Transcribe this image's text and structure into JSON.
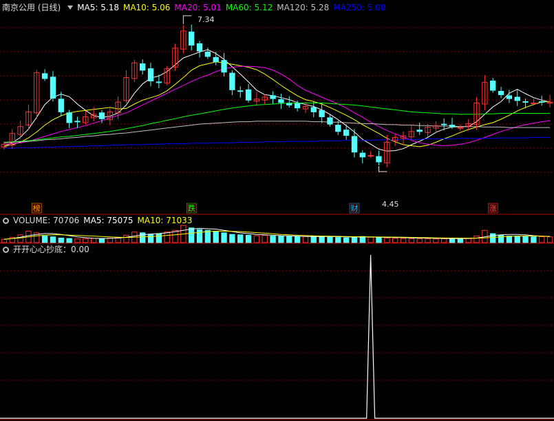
{
  "main_panel": {
    "stock_title": "南京公用 (日线)",
    "indicators": [
      {
        "label": "MA5: 5.18",
        "color": "#ffffff"
      },
      {
        "label": "MA10: 5.06",
        "color": "#ffff00"
      },
      {
        "label": "MA20: 5.01",
        "color": "#ff00ff"
      },
      {
        "label": "MA60: 5.12",
        "color": "#00ff00"
      },
      {
        "label": "MA120: 5.28",
        "color": "#c0c0c0"
      },
      {
        "label": "MA250: 5.08",
        "color": "#0000ff"
      }
    ],
    "high_label": "7.34",
    "low_label": "4.45",
    "event_tags": [
      {
        "text": "榜",
        "color": "#ffa500"
      },
      {
        "text": "跌",
        "color": "#00ff00"
      },
      {
        "text": "财",
        "color": "#00bfff"
      },
      {
        "text": "涨",
        "color": "#ff4040"
      }
    ]
  },
  "volume_panel": {
    "label_volume": "VOLUME: 70706",
    "label_ma5": "MA5: 75075",
    "label_ma10": "MA10: 71033"
  },
  "indicator_panel": {
    "label": "开开心心抄底：0.00"
  },
  "colors": {
    "up": "#ff3232",
    "down": "#54ffff",
    "grid": "#8b0000",
    "border": "#b00000",
    "ma5": "#ffffff",
    "ma10": "#ffff00",
    "ma20": "#ff00ff",
    "ma60": "#00ff00",
    "ma120": "#c0c0c0",
    "ma250": "#0000ff"
  },
  "chart_data": [
    {
      "type": "candlestick",
      "title": "南京公用 (日线)",
      "ylim": [
        4.2,
        7.6
      ],
      "close": [
        4.94,
        5.16,
        5.3,
        5.6,
        6.4,
        6.28,
        5.88,
        5.6,
        5.38,
        5.4,
        5.5,
        5.55,
        5.46,
        5.6,
        5.8,
        6.3,
        6.6,
        6.45,
        6.23,
        6.21,
        6.48,
        6.9,
        7.25,
        6.96,
        6.84,
        6.73,
        6.62,
        6.41,
        6.05,
        6.02,
        5.84,
        5.86,
        5.9,
        5.87,
        5.79,
        5.74,
        5.68,
        5.71,
        5.6,
        5.5,
        5.35,
        5.2,
        5.12,
        4.78,
        4.68,
        4.71,
        4.58,
        4.98,
        5.08,
        5.11,
        5.2,
        5.2,
        5.29,
        5.32,
        5.35,
        5.3,
        5.28,
        5.36,
        5.78,
        6.2,
        6.04,
        5.95,
        5.87,
        5.83,
        5.8,
        5.78,
        5.8,
        5.8
      ],
      "series": [
        {
          "name": "MA5",
          "values": [
            4.9,
            4.97,
            5.08,
            5.25,
            5.49,
            5.75,
            5.9,
            5.96,
            5.91,
            5.76,
            5.63,
            5.52,
            5.49,
            5.51,
            5.58,
            5.74,
            5.98,
            6.17,
            6.29,
            6.33,
            6.42,
            6.56,
            6.7,
            6.76,
            6.82,
            6.87,
            6.79,
            6.67,
            6.52,
            6.37,
            6.21,
            6.04,
            5.95,
            5.93,
            5.89,
            5.85,
            5.79,
            5.75,
            5.71,
            5.64,
            5.55,
            5.44,
            5.32,
            5.19,
            5.04,
            4.94,
            4.84,
            4.8,
            4.81,
            4.85,
            4.93,
            5.0,
            5.08,
            5.18,
            5.25,
            5.29,
            5.3,
            5.3,
            5.4,
            5.55,
            5.7,
            5.81,
            5.98,
            6.06,
            5.97,
            5.89,
            5.84,
            5.8
          ]
        },
        {
          "name": "MA10",
          "values": [
            4.9,
            4.93,
            4.98,
            5.07,
            5.19,
            5.33,
            5.44,
            5.52,
            5.58,
            5.61,
            5.63,
            5.65,
            5.67,
            5.69,
            5.66,
            5.67,
            5.76,
            5.84,
            5.89,
            5.94,
            6.03,
            6.16,
            6.3,
            6.45,
            6.54,
            6.58,
            6.62,
            6.6,
            6.57,
            6.54,
            6.51,
            6.46,
            6.37,
            6.26,
            6.14,
            6.03,
            5.93,
            5.85,
            5.81,
            5.76,
            5.69,
            5.61,
            5.53,
            5.44,
            5.34,
            5.25,
            5.16,
            5.06,
            4.99,
            4.93,
            4.91,
            4.89,
            4.92,
            4.98,
            5.05,
            5.11,
            5.18,
            5.24,
            5.29,
            5.34,
            5.38,
            5.45,
            5.53,
            5.62,
            5.69,
            5.75,
            5.8,
            5.81
          ]
        },
        {
          "name": "MA20",
          "values": [
            4.94,
            4.95,
            4.97,
            5.0,
            5.05,
            5.1,
            5.15,
            5.2,
            5.24,
            5.28,
            5.32,
            5.37,
            5.42,
            5.48,
            5.53,
            5.58,
            5.66,
            5.74,
            5.82,
            5.9,
            5.98,
            6.06,
            6.14,
            6.22,
            6.29,
            6.35,
            6.42,
            6.48,
            6.51,
            6.53,
            6.53,
            6.52,
            6.5,
            6.45,
            6.37,
            6.27,
            6.14,
            6.04,
            5.97,
            5.9,
            5.83,
            5.76,
            5.68,
            5.58,
            5.49,
            5.39,
            5.3,
            5.22,
            5.15,
            5.09,
            5.02,
            4.97,
            4.94,
            4.92,
            4.91,
            4.92,
            4.94,
            4.97,
            5.02,
            5.08,
            5.14,
            5.2,
            5.25,
            5.3,
            5.34,
            5.37,
            5.4,
            5.42
          ]
        },
        {
          "name": "MA60",
          "values": [
            4.98,
            4.99,
            5.0,
            5.01,
            5.03,
            5.05,
            5.07,
            5.09,
            5.1,
            5.12,
            5.14,
            5.16,
            5.18,
            5.2,
            5.23,
            5.26,
            5.29,
            5.32,
            5.36,
            5.39,
            5.43,
            5.46,
            5.5,
            5.53,
            5.56,
            5.59,
            5.62,
            5.65,
            5.68,
            5.7,
            5.72,
            5.74,
            5.75,
            5.76,
            5.77,
            5.78,
            5.78,
            5.78,
            5.78,
            5.78,
            5.77,
            5.76,
            5.75,
            5.74,
            5.72,
            5.7,
            5.68,
            5.66,
            5.64,
            5.62,
            5.6,
            5.59,
            5.58,
            5.57,
            5.56,
            5.56,
            5.55,
            5.55,
            5.55,
            5.56,
            5.56,
            5.57,
            5.57,
            5.57,
            5.57,
            5.57,
            5.57,
            5.57
          ]
        },
        {
          "name": "MA120",
          "values": [
            4.97,
            4.98,
            4.99,
            5.0,
            5.01,
            5.03,
            5.04,
            5.05,
            5.07,
            5.08,
            5.1,
            5.11,
            5.13,
            5.14,
            5.16,
            5.17,
            5.19,
            5.21,
            5.23,
            5.25,
            5.27,
            5.29,
            5.31,
            5.33,
            5.35,
            5.36,
            5.37,
            5.38,
            5.39,
            5.4,
            5.4,
            5.41,
            5.41,
            5.41,
            5.41,
            5.41,
            5.41,
            5.41,
            5.4,
            5.4,
            5.39,
            5.39,
            5.38,
            5.37,
            5.36,
            5.36,
            5.35,
            5.34,
            5.34,
            5.33,
            5.33,
            5.32,
            5.32,
            5.31,
            5.31,
            5.31,
            5.3,
            5.3,
            5.3,
            5.29,
            5.29,
            5.29,
            5.28,
            5.28,
            5.28,
            5.28,
            5.28,
            5.28
          ]
        },
        {
          "name": "MA250",
          "values": [
            4.86,
            4.86,
            4.87,
            4.87,
            4.87,
            4.88,
            4.88,
            4.89,
            4.89,
            4.9,
            4.9,
            4.91,
            4.91,
            4.92,
            4.92,
            4.93,
            4.93,
            4.93,
            4.94,
            4.94,
            4.95,
            4.95,
            4.95,
            4.96,
            4.96,
            4.96,
            4.97,
            4.97,
            4.97,
            4.98,
            4.98,
            4.98,
            4.99,
            4.99,
            4.99,
            5.0,
            5.0,
            5.0,
            5.0,
            5.01,
            5.01,
            5.01,
            5.02,
            5.02,
            5.02,
            5.02,
            5.03,
            5.03,
            5.03,
            5.04,
            5.04,
            5.04,
            5.05,
            5.05,
            5.05,
            5.05,
            5.06,
            5.06,
            5.06,
            5.06,
            5.06,
            5.07,
            5.07,
            5.07,
            5.07,
            5.08,
            5.08,
            5.08
          ]
        }
      ]
    },
    {
      "type": "bar",
      "title": "VOLUME",
      "values": [
        40,
        65,
        95,
        140,
        120,
        80,
        70,
        55,
        50,
        45,
        48,
        52,
        50,
        55,
        62,
        90,
        130,
        120,
        100,
        110,
        130,
        150,
        210,
        180,
        160,
        150,
        140,
        120,
        100,
        95,
        90,
        85,
        88,
        80,
        78,
        75,
        72,
        76,
        80,
        70,
        66,
        62,
        58,
        70,
        75,
        66,
        60,
        55,
        52,
        50,
        48,
        46,
        45,
        44,
        46,
        48,
        50,
        52,
        80,
        150,
        110,
        90,
        80,
        78,
        72,
        70,
        72,
        70
      ],
      "series": [
        {
          "name": "MA5",
          "values": [
            40,
            50,
            65,
            85,
            100,
            110,
            110,
            100,
            85,
            70,
            60,
            52,
            50,
            52,
            55,
            65,
            80,
            95,
            105,
            110,
            120,
            135,
            150,
            165,
            175,
            170,
            165,
            150,
            135,
            120,
            110,
            100,
            95,
            90,
            85,
            82,
            78,
            75,
            75,
            75,
            74,
            72,
            70,
            68,
            68,
            68,
            66,
            64,
            62,
            60,
            58,
            56,
            54,
            52,
            50,
            49,
            48,
            48,
            55,
            70,
            85,
            95,
            100,
            100,
            95,
            85,
            78,
            75
          ]
        },
        {
          "name": "MA10",
          "values": [
            40,
            48,
            58,
            70,
            82,
            90,
            95,
            95,
            92,
            88,
            84,
            80,
            75,
            70,
            65,
            62,
            65,
            70,
            75,
            80,
            88,
            95,
            105,
            115,
            125,
            135,
            140,
            140,
            138,
            135,
            130,
            122,
            115,
            108,
            100,
            95,
            90,
            86,
            83,
            80,
            78,
            76,
            74,
            72,
            71,
            70,
            69,
            68,
            67,
            66,
            64,
            62,
            60,
            58,
            56,
            55,
            54,
            53,
            54,
            58,
            64,
            70,
            76,
            80,
            82,
            80,
            78,
            76
          ]
        }
      ]
    },
    {
      "type": "line",
      "title": "开开心心抄底",
      "values": [
        0,
        0,
        0,
        0,
        0,
        0,
        0,
        0,
        0,
        0,
        0,
        0,
        0,
        0,
        0,
        0,
        0,
        0,
        0,
        0,
        0,
        0,
        0,
        0,
        0,
        0,
        0,
        0,
        0,
        0,
        0,
        0,
        0,
        0,
        0,
        0,
        0,
        0,
        0,
        0,
        0,
        0,
        0,
        0,
        0,
        1,
        0,
        0,
        0,
        0,
        0,
        0,
        0,
        0,
        0,
        0,
        0,
        0,
        0,
        0,
        0,
        0,
        0,
        0,
        0,
        0,
        0,
        0
      ]
    }
  ]
}
